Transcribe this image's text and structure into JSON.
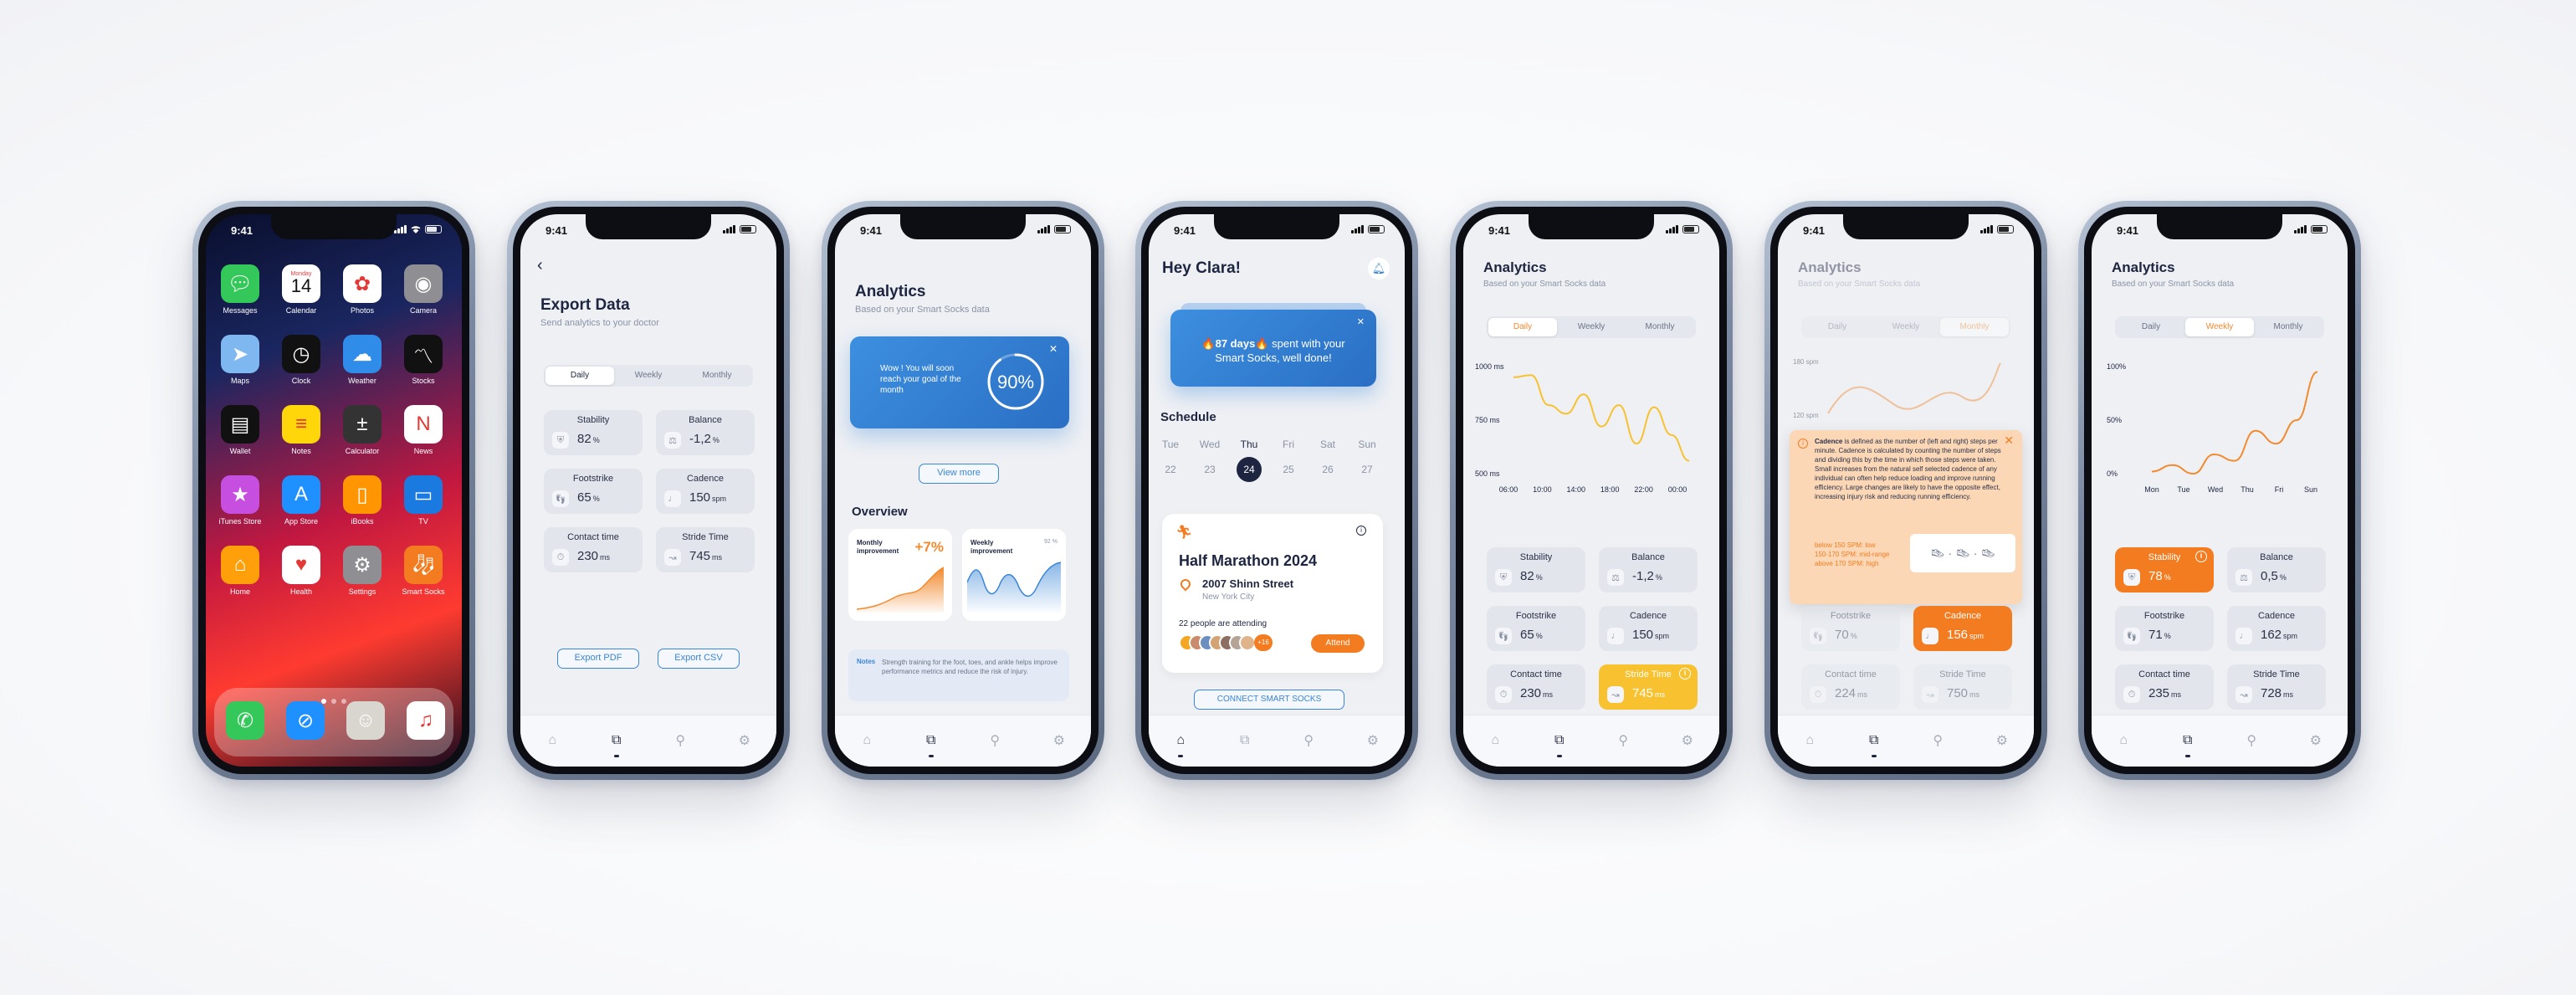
{
  "status_time": "9:41",
  "home": {
    "date_day": "Monday",
    "date_num": "14",
    "apps": [
      {
        "label": "Messages",
        "icon": "messages-icon",
        "color": "#34c759"
      },
      {
        "label": "Calendar",
        "icon": "calendar-icon",
        "color": "#ffffff"
      },
      {
        "label": "Photos",
        "icon": "photos-icon",
        "color": "#ffffff"
      },
      {
        "label": "Camera",
        "icon": "camera-icon",
        "color": "#8e8e93"
      },
      {
        "label": "Maps",
        "icon": "maps-icon",
        "color": "#7fb8f0"
      },
      {
        "label": "Clock",
        "icon": "clock-icon",
        "color": "#111111"
      },
      {
        "label": "Weather",
        "icon": "weather-icon",
        "color": "#2f8ce8"
      },
      {
        "label": "Stocks",
        "icon": "stocks-icon",
        "color": "#111111"
      },
      {
        "label": "Wallet",
        "icon": "wallet-icon",
        "color": "#111111"
      },
      {
        "label": "Notes",
        "icon": "notes-icon",
        "color": "#ffd60a"
      },
      {
        "label": "Calculator",
        "icon": "calculator-icon",
        "color": "#333333"
      },
      {
        "label": "News",
        "icon": "news-icon",
        "color": "#ffffff"
      },
      {
        "label": "iTunes Store",
        "icon": "itunes-icon",
        "color": "#c64fe0"
      },
      {
        "label": "App Store",
        "icon": "appstore-icon",
        "color": "#1e90ff"
      },
      {
        "label": "iBooks",
        "icon": "ibooks-icon",
        "color": "#ff9500"
      },
      {
        "label": "TV",
        "icon": "tv-icon",
        "color": "#1a7ae0"
      },
      {
        "label": "Home",
        "icon": "home-app-icon",
        "color": "#ff9f0a"
      },
      {
        "label": "Health",
        "icon": "health-icon",
        "color": "#ffffff"
      },
      {
        "label": "Settings",
        "icon": "settings-icon",
        "color": "#8e8e93"
      },
      {
        "label": "Smart Socks",
        "icon": "socks-icon",
        "color": "#f47c20"
      }
    ],
    "dock": [
      {
        "icon": "phone-icon",
        "color": "#34c759"
      },
      {
        "icon": "safari-icon",
        "color": "#1e90ff"
      },
      {
        "icon": "contacts-icon",
        "color": "#d9d5cf"
      },
      {
        "icon": "music-icon",
        "color": "#ffffff"
      }
    ]
  },
  "export": {
    "title": "Export Data",
    "subtitle": "Send analytics to your doctor",
    "tabs": [
      "Daily",
      "Weekly",
      "Monthly"
    ],
    "metrics": [
      {
        "label": "Stability",
        "value": "82",
        "unit": "%"
      },
      {
        "label": "Balance",
        "value": "-1,2",
        "unit": "%"
      },
      {
        "label": "Footstrike",
        "value": "65",
        "unit": "%"
      },
      {
        "label": "Cadence",
        "value": "150",
        "unit": "spm"
      },
      {
        "label": "Contact time",
        "value": "230",
        "unit": "ms"
      },
      {
        "label": "Stride Time",
        "value": "745",
        "unit": "ms"
      }
    ],
    "export_pdf": "Export PDF",
    "export_csv": "Export CSV"
  },
  "analytics_overview": {
    "title": "Analytics",
    "subtitle": "Based on your Smart Socks data",
    "goal_text": "Wow ! You will soon reach your goal of the month",
    "goal_percent": "90%",
    "goal_fraction": 0.9,
    "view_more": "View more",
    "overview_title": "Overview",
    "monthly_label": "Monthly improvement",
    "monthly_value": "+7%",
    "weekly_label": "Weekly improvement",
    "weekly_value": "92 %",
    "notes_label": "Notes",
    "notes_text": "Strength training for the foot, toes, and ankle helps improve performance metrics and reduce the risk of injury."
  },
  "home_app": {
    "greeting": "Hey Clara!",
    "streak_days": "🔥87 days🔥",
    "streak_text": "spent with your Smart Socks, well done!",
    "schedule_title": "Schedule",
    "days": [
      "Tue",
      "Wed",
      "Thu",
      "Fri",
      "Sat",
      "Sun"
    ],
    "dates": [
      "22",
      "23",
      "24",
      "25",
      "26",
      "27"
    ],
    "selected_index": 2,
    "event_title": "Half Marathon 2024",
    "event_street": "2007 Shinn Street",
    "event_city": "New York City",
    "attending_text": "22 people are attending",
    "more_count": "+16",
    "attend_label": "Attend",
    "connect_label": "CONNECT SMART SOCKS"
  },
  "analytics_daily": {
    "title": "Analytics",
    "subtitle": "Based on your Smart Socks data",
    "tabs": [
      "Daily",
      "Weekly",
      "Monthly"
    ],
    "chart_data": {
      "type": "line",
      "x": [
        "06:00",
        "10:00",
        "14:00",
        "18:00",
        "22:00",
        "00:00"
      ],
      "y_ticks": [
        "1000 ms",
        "750 ms",
        "500 ms"
      ],
      "ylim": [
        500,
        1000
      ],
      "values": [
        950,
        960,
        820,
        780,
        870,
        720,
        820,
        640,
        810,
        680,
        560
      ],
      "color": "#f7c12f"
    },
    "metrics": [
      {
        "label": "Stability",
        "value": "82",
        "unit": "%"
      },
      {
        "label": "Balance",
        "value": "-1,2",
        "unit": "%"
      },
      {
        "label": "Footstrike",
        "value": "65",
        "unit": "%"
      },
      {
        "label": "Cadence",
        "value": "150",
        "unit": "spm"
      },
      {
        "label": "Contact time",
        "value": "230",
        "unit": "ms"
      },
      {
        "label": "Stride Time",
        "value": "745",
        "unit": "ms"
      }
    ]
  },
  "analytics_monthly": {
    "title": "Analytics",
    "subtitle": "Based on your Smart Socks data",
    "tabs": [
      "Daily",
      "Weekly",
      "Monthly"
    ],
    "y_ticks": [
      "180 spm",
      "120 spm"
    ],
    "tooltip_term": "Cadence",
    "tooltip_text": "is defined as the number of (left and right) steps per minute. Cadence is calculated by counting the number of steps and dividing this by the time in which those steps were taken. Small increases from the natural self selected cadence of any individual can often help reduce loading and improve running efficiency. Large changes are likely to have the opposite effect, increasing injury risk and reducing running efficiency.",
    "ranges": [
      "below 150 SPM: low",
      "150-170 SPM: mid-range",
      "above 170 SPM: high"
    ],
    "metrics": [
      {
        "label": "Footstrike",
        "value": "70",
        "unit": "%"
      },
      {
        "label": "Cadence",
        "value": "156",
        "unit": "spm"
      },
      {
        "label": "Contact time",
        "value": "224",
        "unit": "ms"
      },
      {
        "label": "Stride Time",
        "value": "750",
        "unit": "ms"
      }
    ]
  },
  "analytics_weekly": {
    "title": "Analytics",
    "subtitle": "Based on your Smart Socks data",
    "tabs": [
      "Daily",
      "Weekly",
      "Monthly"
    ],
    "chart_data": {
      "type": "line",
      "x": [
        "Mon",
        "Tue",
        "Wed",
        "Thu",
        "Fri",
        "Sun"
      ],
      "y_ticks": [
        "100%",
        "50%",
        "0%"
      ],
      "ylim": [
        0,
        100
      ],
      "values": [
        2,
        8,
        0,
        18,
        12,
        40,
        28,
        50,
        95
      ],
      "color": "#f28a2e"
    },
    "metrics": [
      {
        "label": "Stability",
        "value": "78",
        "unit": "%"
      },
      {
        "label": "Balance",
        "value": "0,5",
        "unit": "%"
      },
      {
        "label": "Footstrike",
        "value": "71",
        "unit": "%"
      },
      {
        "label": "Cadence",
        "value": "162",
        "unit": "spm"
      },
      {
        "label": "Contact time",
        "value": "235",
        "unit": "ms"
      },
      {
        "label": "Stride Time",
        "value": "728",
        "unit": "ms"
      }
    ]
  }
}
